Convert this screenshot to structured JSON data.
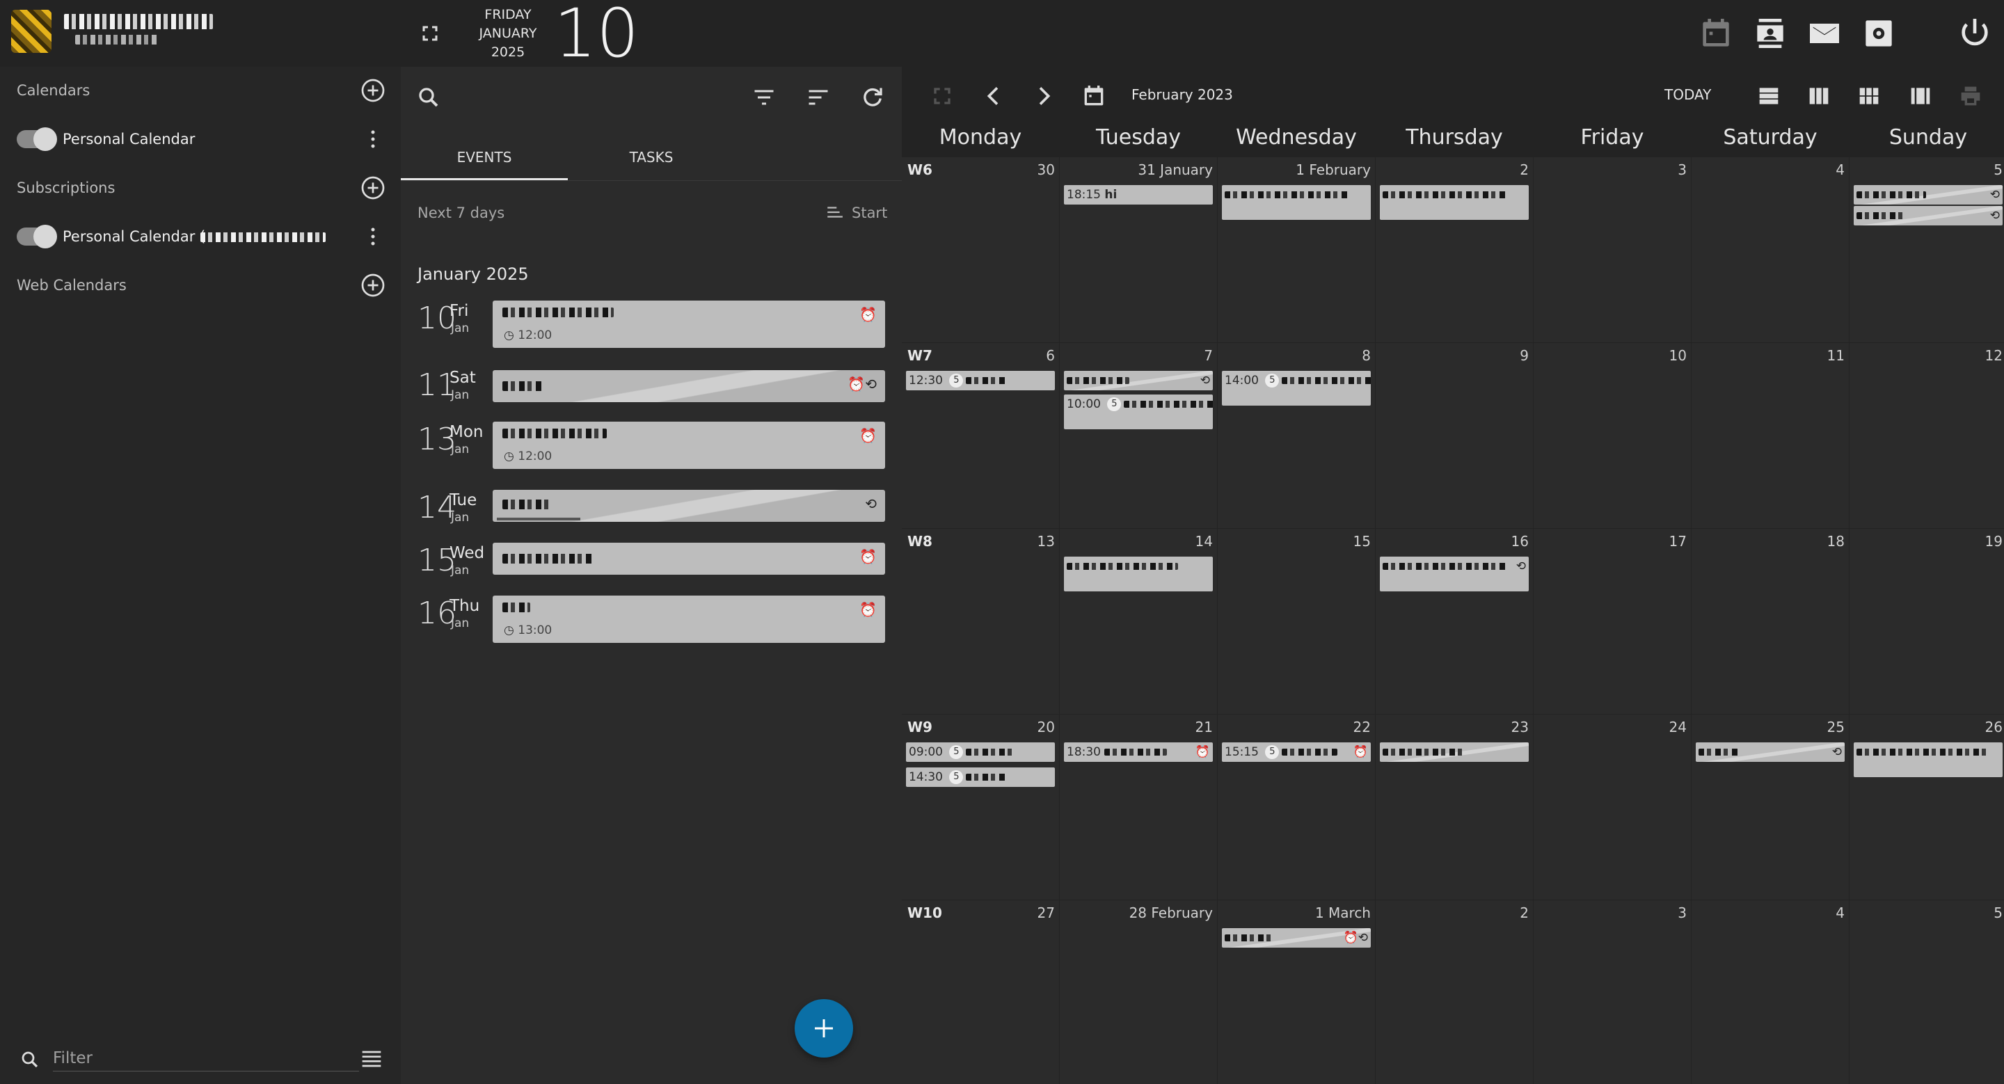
{
  "topbar": {
    "weekday": "FRIDAY",
    "month": "JANUARY",
    "year": "2025",
    "day": "10"
  },
  "sidebar": {
    "calendars_title": "Calendars",
    "calendar_item": "Personal Calendar",
    "subscriptions_title": "Subscriptions",
    "subscription_item": "Personal Calendar (",
    "web_calendars_title": "Web Calendars",
    "filter_placeholder": "Filter"
  },
  "list": {
    "tabs": [
      "EVENTS",
      "TASKS"
    ],
    "range_label": "Next 7 days",
    "sort_label": "Start",
    "month_header": "January 2025",
    "days": [
      {
        "num": "10",
        "weekday": "Fri",
        "month": "Jan",
        "time": "12:00",
        "icons": "⏰"
      },
      {
        "num": "11",
        "weekday": "Sat",
        "month": "Jan",
        "time": "",
        "icons": "⏰⟲"
      },
      {
        "num": "13",
        "weekday": "Mon",
        "month": "Jan",
        "time": "12:00",
        "icons": "⏰"
      },
      {
        "num": "14",
        "weekday": "Tue",
        "month": "Jan",
        "time": "",
        "icons": "⟲"
      },
      {
        "num": "15",
        "weekday": "Wed",
        "month": "Jan",
        "time": "",
        "icons": "⏰"
      },
      {
        "num": "16",
        "weekday": "Thu",
        "month": "Jan",
        "time": "13:00",
        "icons": "⏰"
      }
    ]
  },
  "calendar": {
    "title": "February 2023",
    "today_label": "TODAY",
    "weekdays": [
      "Monday",
      "Tuesday",
      "Wednesday",
      "Thursday",
      "Friday",
      "Saturday",
      "Sunday"
    ],
    "weeks": [
      {
        "label": "W6",
        "dates": [
          "30",
          "31 January",
          "1 February",
          "2",
          "3",
          "4",
          "5"
        ]
      },
      {
        "label": "W7",
        "dates": [
          "6",
          "7",
          "8",
          "9",
          "10",
          "11",
          "12"
        ]
      },
      {
        "label": "W8",
        "dates": [
          "13",
          "14",
          "15",
          "16",
          "17",
          "18",
          "19"
        ]
      },
      {
        "label": "W9",
        "dates": [
          "20",
          "21",
          "22",
          "23",
          "24",
          "25",
          "26"
        ]
      },
      {
        "label": "W10",
        "dates": [
          "27",
          "28 February",
          "1 March",
          "2",
          "3",
          "4",
          "5"
        ]
      }
    ],
    "event_times": {
      "tue31": "18:15",
      "tue31_title": "hi",
      "mon6": "12:30",
      "tue7": "10:00",
      "wed8": "14:00",
      "mon20a": "09:00",
      "mon20b": "14:30",
      "tue21": "18:30",
      "wed22": "15:15"
    },
    "badge": "5"
  }
}
